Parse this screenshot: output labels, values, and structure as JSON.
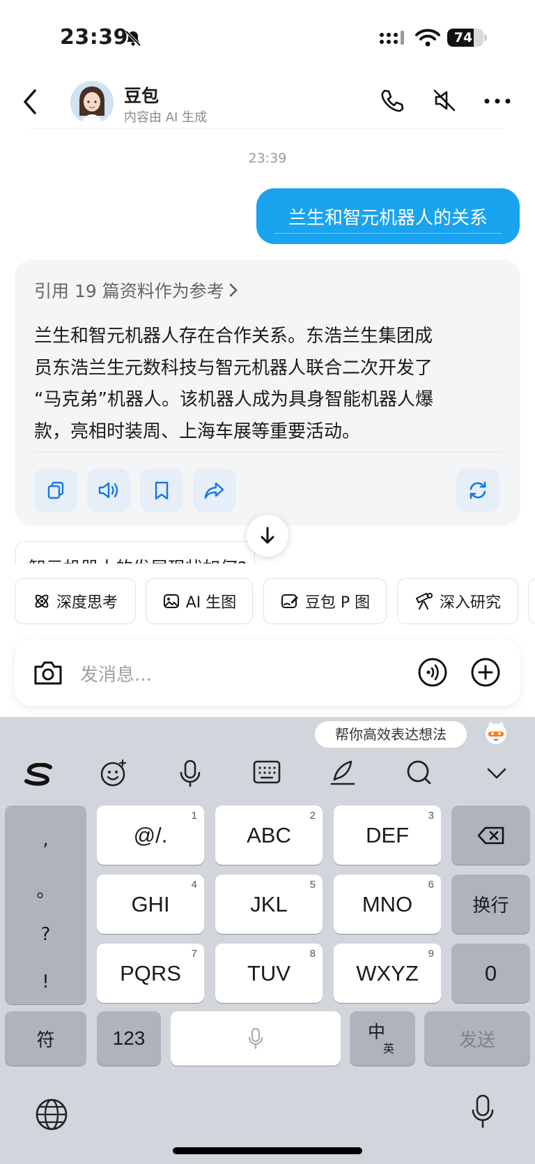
{
  "status_bar": {
    "time": "23:39",
    "battery": "74",
    "battery_level": 0.74
  },
  "header": {
    "name": "豆包",
    "subtitle": "内容由 AI 生成"
  },
  "conversation": {
    "timestamp": "23:39",
    "user_message": "兰生和智元机器人的关系",
    "reference_label": "引用 19 篇资料作为参考",
    "answer_lines": [
      "兰生和智元机器人存在合作关系。东浩兰生集团成",
      "员东浩兰生元数科技与智元机器人联合二次开发了",
      "“马克弟”机器人。该机器人成为具身智能机器人爆",
      "款，亮相时装周、上海车展等重要活动。"
    ],
    "suggestion": "智元机器人的发展现状如何?"
  },
  "chips": [
    {
      "label": "深度思考",
      "icon": "atom-icon"
    },
    {
      "label": "AI 生图",
      "icon": "image-icon"
    },
    {
      "label": "豆包 P 图",
      "icon": "edit-image-icon"
    },
    {
      "label": "深入研究",
      "icon": "telescope-icon"
    }
  ],
  "composer": {
    "placeholder": "发消息..."
  },
  "keyboard": {
    "tip": "帮你高效表达想法",
    "punctuation": [
      ",",
      "。",
      "?",
      "!"
    ],
    "rows": [
      [
        {
          "label": "@/.",
          "num": "1"
        },
        {
          "label": "ABC",
          "num": "2"
        },
        {
          "label": "DEF",
          "num": "3"
        }
      ],
      [
        {
          "label": "GHI",
          "num": "4"
        },
        {
          "label": "JKL",
          "num": "5"
        },
        {
          "label": "MNO",
          "num": "6"
        }
      ],
      [
        {
          "label": "PQRS",
          "num": "7"
        },
        {
          "label": "TUV",
          "num": "8"
        },
        {
          "label": "WXYZ",
          "num": "9"
        }
      ]
    ],
    "newline": "换行",
    "zero": "0",
    "symbols": "符",
    "numbers": "123",
    "lang_main": "中",
    "lang_sub": "英",
    "send": "发送"
  }
}
